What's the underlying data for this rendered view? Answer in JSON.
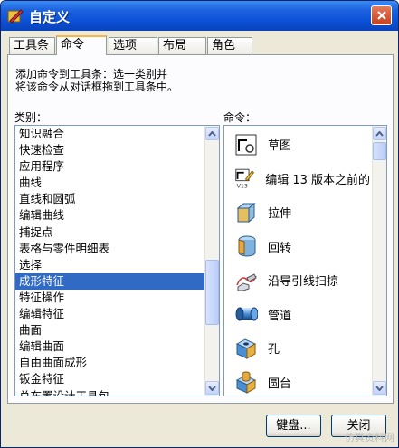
{
  "window": {
    "title": "自定义"
  },
  "tabs": [
    {
      "label": "工具条"
    },
    {
      "label": "命令"
    },
    {
      "label": "选项"
    },
    {
      "label": "布局"
    },
    {
      "label": "角色"
    }
  ],
  "instructions": {
    "line1": "添加命令到工具条：选一类别并",
    "line2": "将该命令从对话框拖到工具条中。"
  },
  "categories_label": "类别：",
  "commands_label": "命令：",
  "categories": [
    "知识融合",
    "快速检查",
    "应用程序",
    "曲线",
    "直线和圆弧",
    "编辑曲线",
    "捕捉点",
    "表格与零件明细表",
    "选择",
    "成形特征",
    "特征操作",
    "编辑特征",
    "曲面",
    "编辑曲面",
    "自由曲面成形",
    "钣金特征",
    "总布置设计工具包"
  ],
  "selected_category": "成形特征",
  "commands": [
    {
      "label": "草图",
      "icon": "sketch-icon"
    },
    {
      "label": "编辑 13 版本之前的",
      "icon": "edit-v13-icon"
    },
    {
      "label": "拉伸",
      "icon": "extrude-icon"
    },
    {
      "label": "回转",
      "icon": "revolve-icon"
    },
    {
      "label": "沿导引线扫掠",
      "icon": "sweep-icon"
    },
    {
      "label": "管道",
      "icon": "tube-icon"
    },
    {
      "label": "孔",
      "icon": "hole-icon"
    },
    {
      "label": "圆台",
      "icon": "boss-icon"
    }
  ],
  "buttons": {
    "keyboard": "键盘...",
    "close": "关闭"
  },
  "watermark": "仿真资料网"
}
